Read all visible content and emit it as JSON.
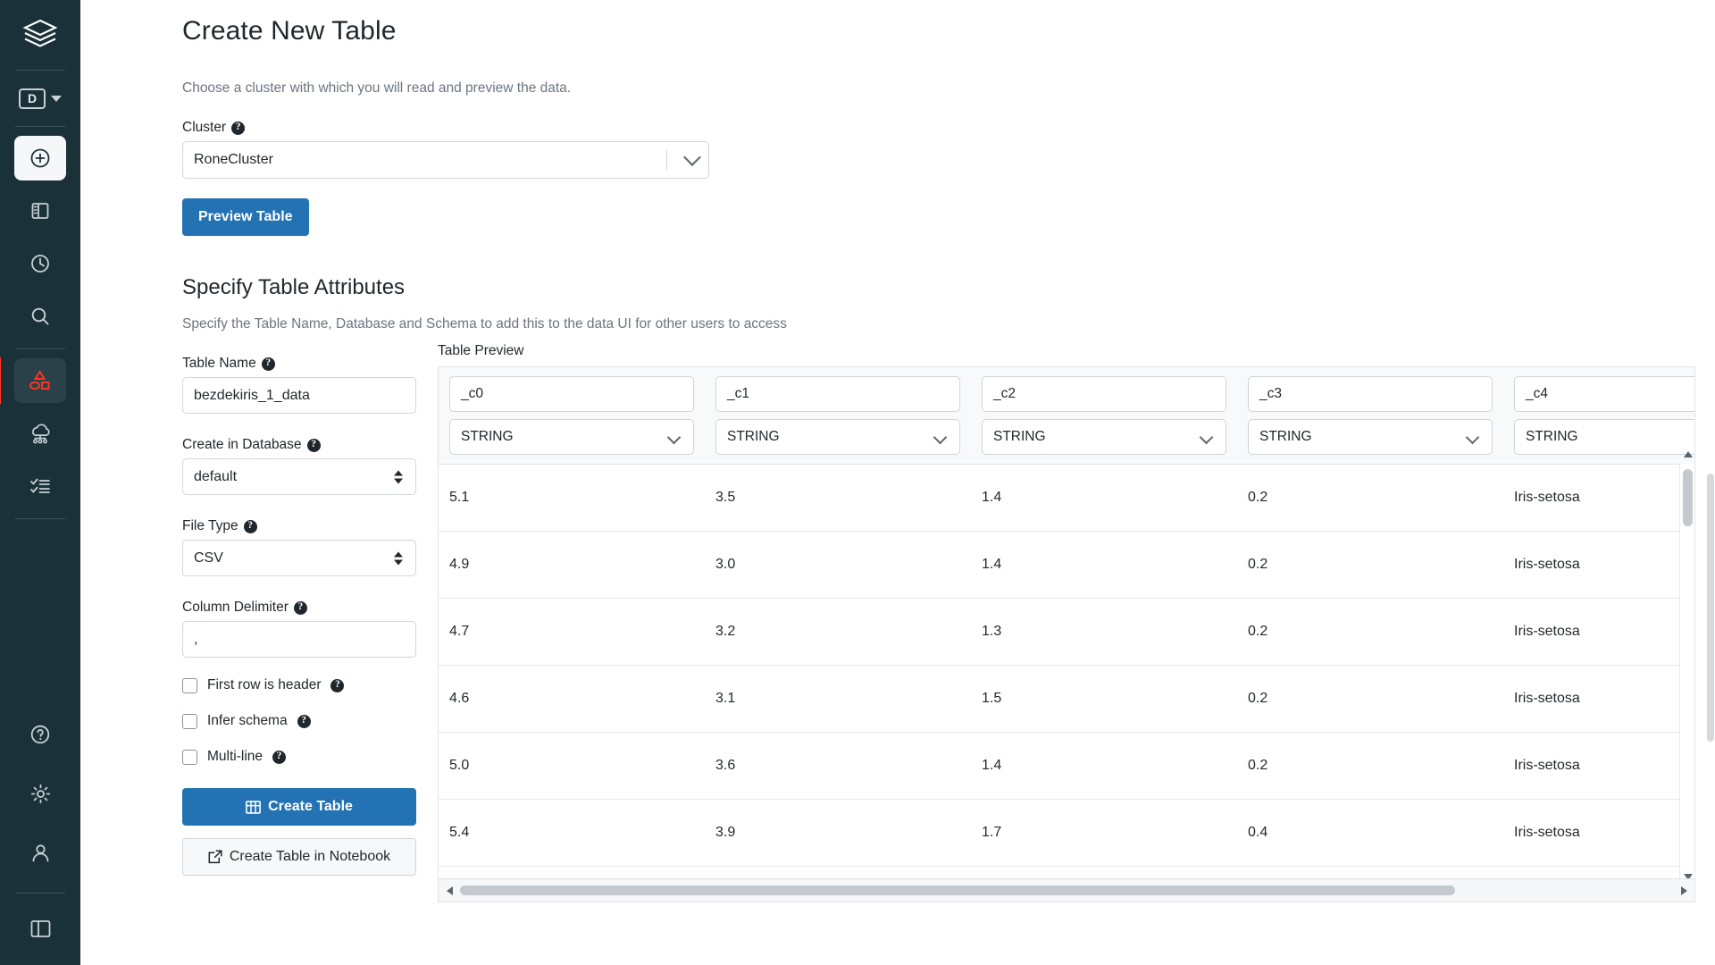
{
  "sidebar": {
    "logo_name": "databricks-logo",
    "workspace_label": "D",
    "items": [
      {
        "name": "new-item",
        "icon": "plus-circle-icon",
        "state": "active-light"
      },
      {
        "name": "workspace-item",
        "icon": "notebook-icon",
        "state": ""
      },
      {
        "name": "recents-item",
        "icon": "clock-icon",
        "state": ""
      },
      {
        "name": "search-item",
        "icon": "search-icon",
        "state": ""
      },
      {
        "name": "data-item",
        "icon": "shapes-icon",
        "state": "active-dark"
      },
      {
        "name": "compute-item",
        "icon": "clusters-icon",
        "state": ""
      },
      {
        "name": "jobs-item",
        "icon": "checklist-icon",
        "state": ""
      }
    ],
    "bottom_items": [
      {
        "name": "help-item",
        "icon": "question-circle-icon"
      },
      {
        "name": "settings-item",
        "icon": "gear-icon"
      },
      {
        "name": "account-item",
        "icon": "person-icon"
      },
      {
        "name": "panel-toggle-item",
        "icon": "sidebar-toggle-icon"
      }
    ]
  },
  "page": {
    "title": "Create New Table",
    "subtitle": "Choose a cluster with which you will read and preview the data."
  },
  "cluster": {
    "label": "Cluster",
    "value": "RoneCluster",
    "preview_button": "Preview Table"
  },
  "attributes": {
    "section_title": "Specify Table Attributes",
    "section_sub": "Specify the Table Name, Database and Schema to add this to the data UI for other users to access",
    "table_name_label": "Table Name",
    "table_name_value": "bezdekiris_1_data",
    "database_label": "Create in Database",
    "database_value": "default",
    "file_type_label": "File Type",
    "file_type_value": "CSV",
    "delimiter_label": "Column Delimiter",
    "delimiter_value": ",",
    "checkbox_first_row": "First row is header",
    "checkbox_infer_schema": "Infer schema",
    "checkbox_multiline": "Multi-line",
    "create_table_button": "Create Table",
    "create_notebook_button": "Create Table in Notebook"
  },
  "preview": {
    "title": "Table Preview",
    "columns": [
      {
        "name": "_c0",
        "type": "STRING"
      },
      {
        "name": "_c1",
        "type": "STRING"
      },
      {
        "name": "_c2",
        "type": "STRING"
      },
      {
        "name": "_c3",
        "type": "STRING"
      },
      {
        "name": "_c4",
        "type": "STRING"
      }
    ],
    "rows": [
      [
        "5.1",
        "3.5",
        "1.4",
        "0.2",
        "Iris-setosa"
      ],
      [
        "4.9",
        "3.0",
        "1.4",
        "0.2",
        "Iris-setosa"
      ],
      [
        "4.7",
        "3.2",
        "1.3",
        "0.2",
        "Iris-setosa"
      ],
      [
        "4.6",
        "3.1",
        "1.5",
        "0.2",
        "Iris-setosa"
      ],
      [
        "5.0",
        "3.6",
        "1.4",
        "0.2",
        "Iris-setosa"
      ],
      [
        "5.4",
        "3.9",
        "1.7",
        "0.4",
        "Iris-setosa"
      ]
    ]
  },
  "colors": {
    "sidebar_bg": "#1B3139",
    "accent_red": "#FF3621",
    "primary_blue": "#2272B4"
  }
}
